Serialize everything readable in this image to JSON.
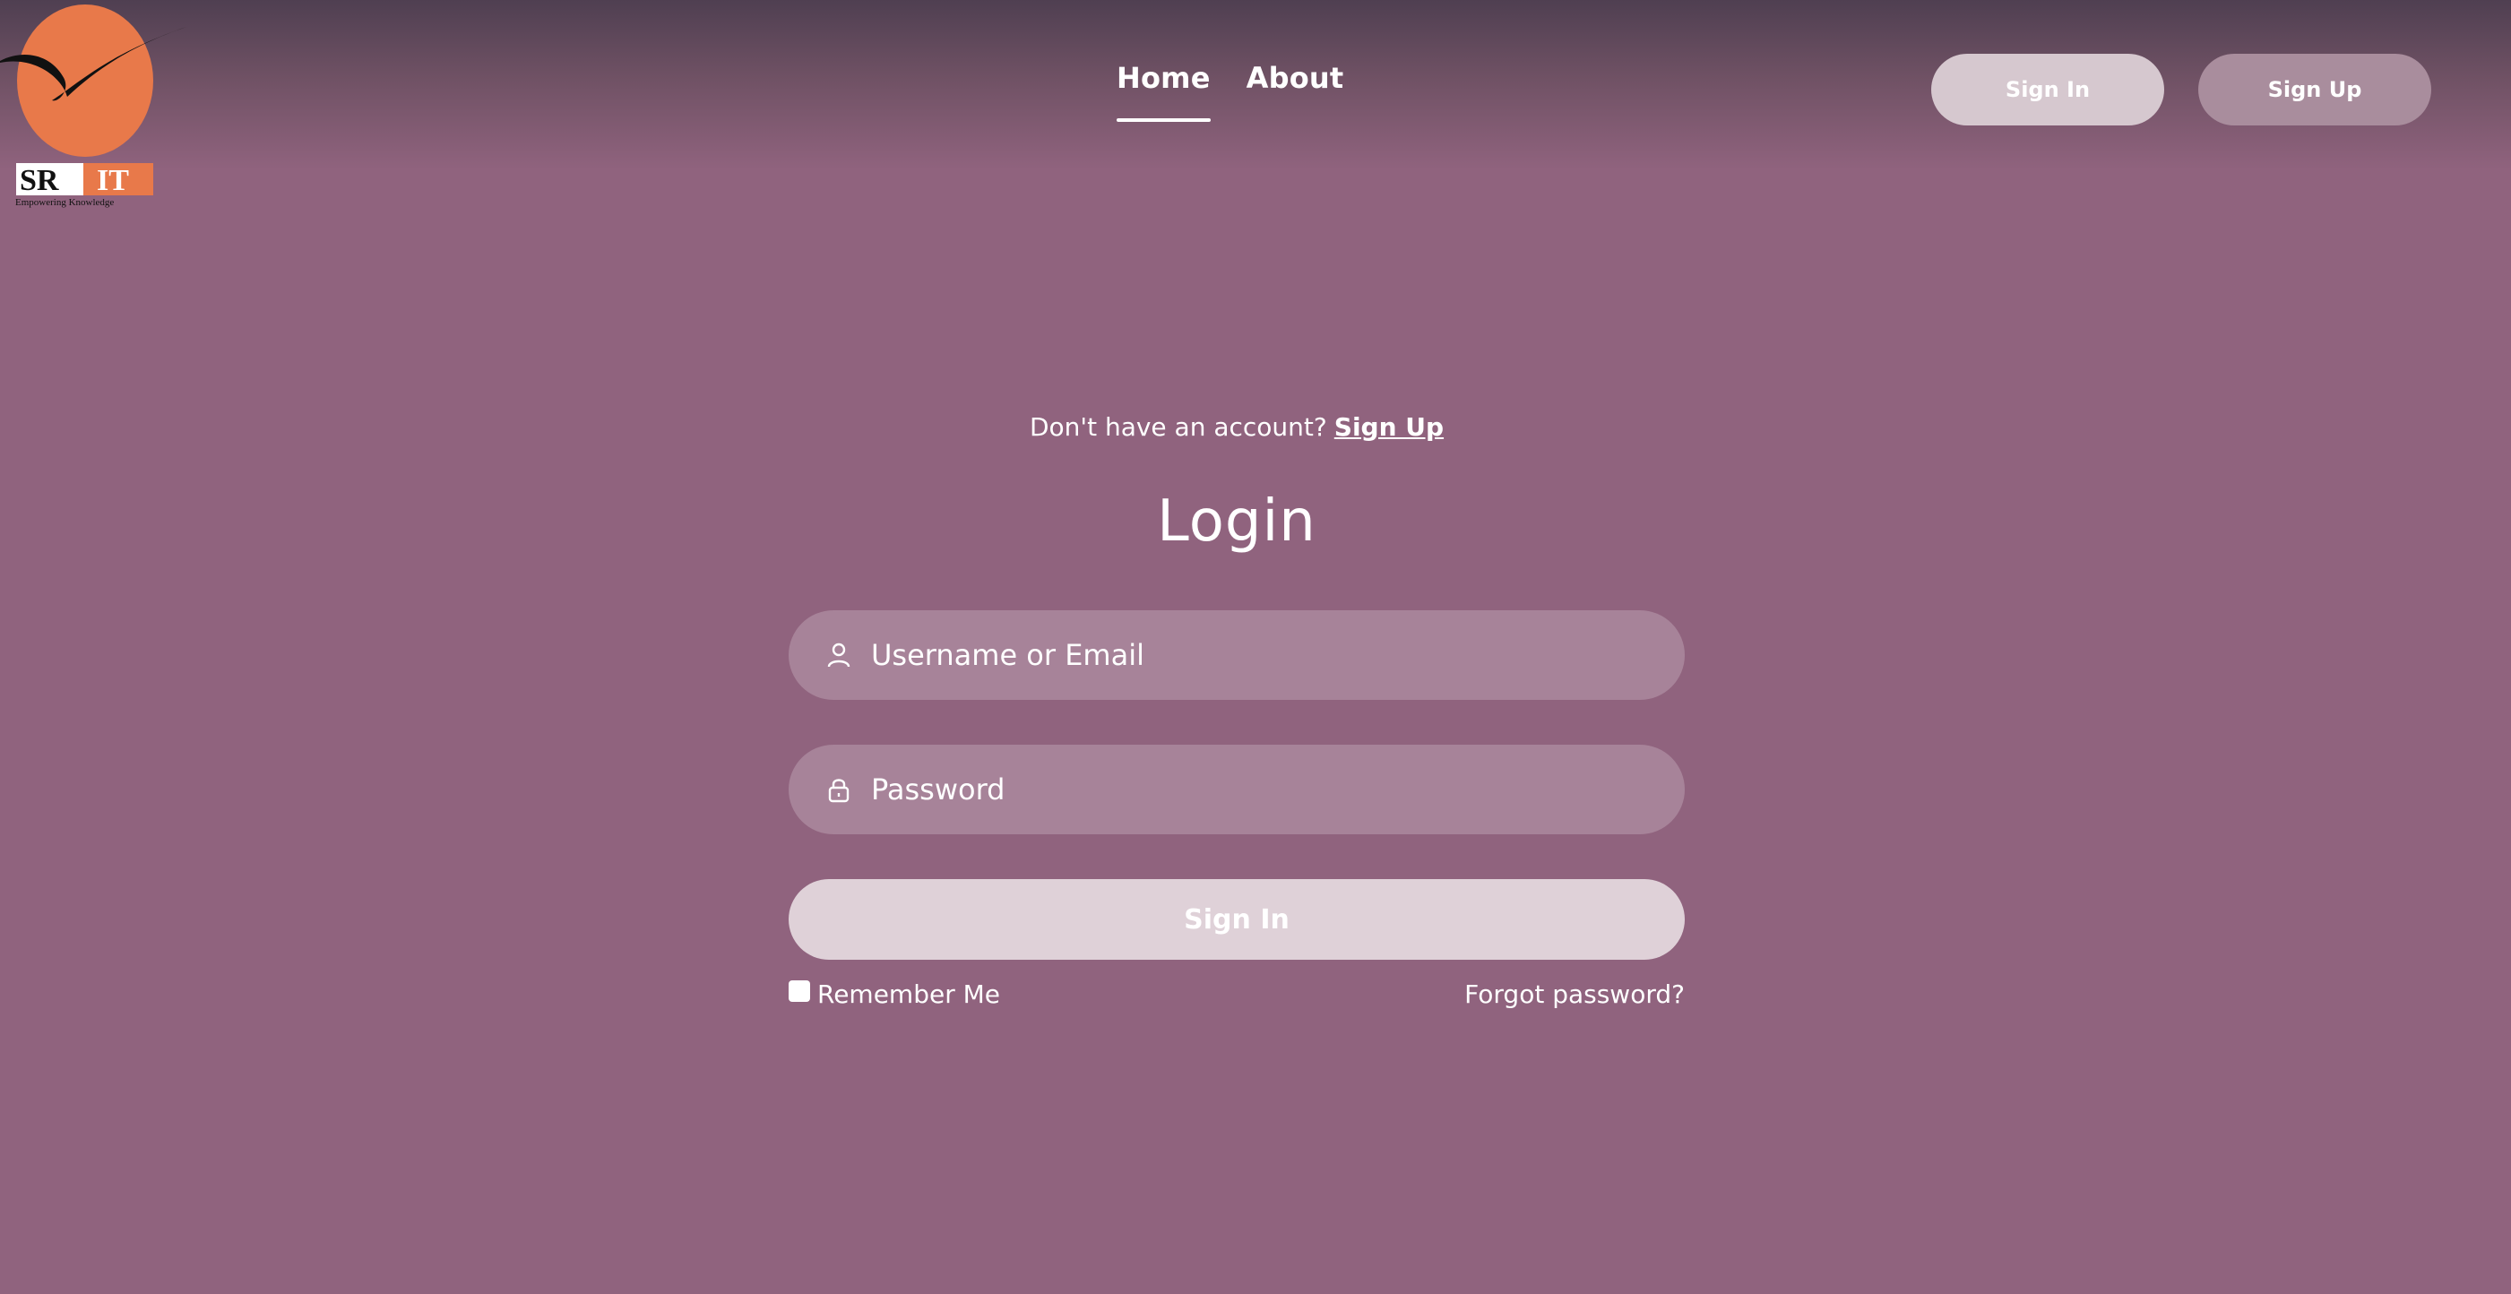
{
  "logo": {
    "main_text_left": "SR",
    "main_text_right": "IT",
    "tagline": "Empowering Knowledge",
    "circle_color": "#e8794a"
  },
  "nav": {
    "items": [
      {
        "label": "Home",
        "active": true
      },
      {
        "label": "About",
        "active": false
      }
    ]
  },
  "header": {
    "sign_in_label": "Sign In",
    "sign_up_label": "Sign Up"
  },
  "form": {
    "prompt_text": "Don't have an account?",
    "prompt_link": "Sign Up",
    "title": "Login",
    "username_placeholder": "Username or Email",
    "username_icon": "user-icon",
    "password_placeholder": "Password",
    "password_icon": "lock-icon",
    "submit_label": "Sign In",
    "remember_label": "Remember Me",
    "remember_checked": false,
    "forgot_label": "Forgot password?"
  },
  "colors": {
    "background": "#90637e",
    "field_bg": "#a78399",
    "submit_bg": "#dfd1d8",
    "header_signin_bg": "#d6c8cf",
    "header_signup_bg": "#a98d9d"
  }
}
